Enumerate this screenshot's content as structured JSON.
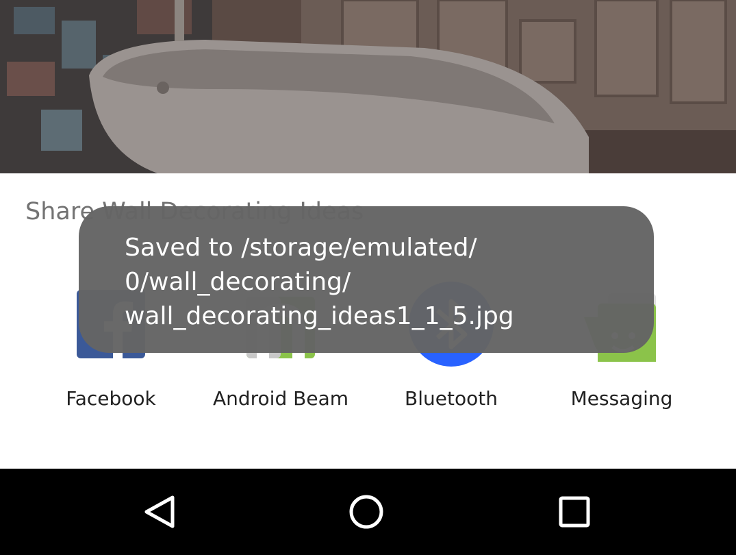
{
  "share_sheet": {
    "title": "Share Wall Decorating Ideas",
    "targets": [
      {
        "label": "Facebook",
        "icon": "facebook-icon",
        "color": "#3b5998"
      },
      {
        "label": "Android Beam",
        "icon": "android-beam-icon",
        "color": "#8bc34a"
      },
      {
        "label": "Bluetooth",
        "icon": "bluetooth-icon",
        "color": "#2962ff"
      },
      {
        "label": "Messaging",
        "icon": "messaging-icon",
        "color": "#8bc34a"
      }
    ]
  },
  "toast": {
    "lines": [
      "Saved to /storage/emulated/",
      "0/wall_decorating/",
      "wall_decorating_ideas1_1_5.jpg"
    ]
  },
  "navigation": {
    "back": "back-icon",
    "home": "home-icon",
    "recents": "recents-icon"
  }
}
